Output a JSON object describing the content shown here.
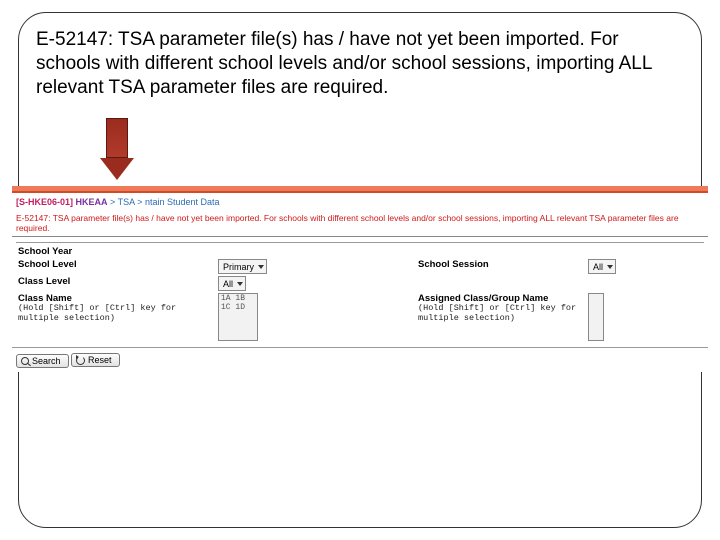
{
  "callout_text": "E-52147: TSA parameter file(s) has / have not yet been imported. For schools with different school levels and/or school sessions, importing ALL relevant TSA parameter files are required.",
  "breadcrumb": {
    "code": "[S-HKE06-01]",
    "trail_a": "HKEAA",
    "trail_b": "TSA",
    "trail_c": "ntain Student Data"
  },
  "error_msg": "E-52147: TSA parameter file(s) has / have not yet been imported. For schools with different school levels and/or school sessions, importing ALL relevant TSA parameter files are required.",
  "section_head": "",
  "labels": {
    "school_year": "School Year",
    "school_level": "School Level",
    "class_level": "Class Level",
    "class_name": "Class Name",
    "school_session": "School Session",
    "assigned": "Assigned Class/Group Name",
    "hint": "(Hold [Shift] or [Ctrl] key for multiple selection)"
  },
  "controls": {
    "school_level_value": "Primary",
    "class_level_value": "All",
    "school_session_value": "All",
    "class_name_options": "1A\n1B\n1C\n1D"
  },
  "buttons": {
    "search": "Search",
    "reset": "Reset"
  }
}
